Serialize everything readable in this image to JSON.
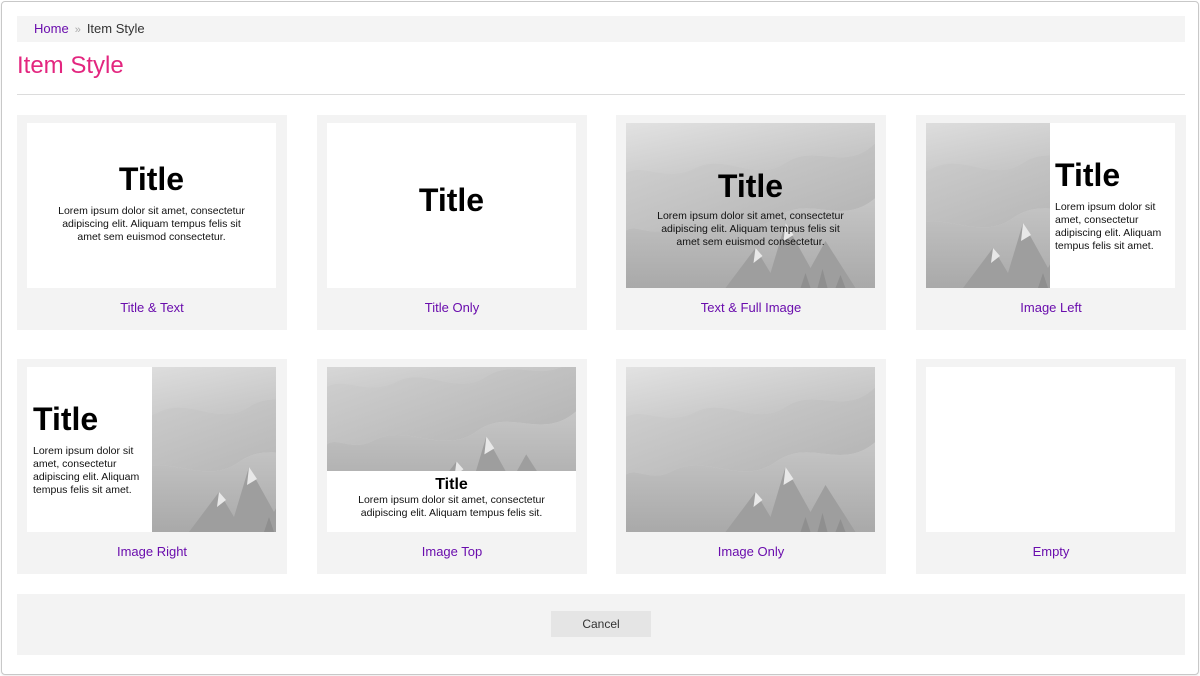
{
  "breadcrumb": {
    "home": "Home",
    "separator": "»",
    "current": "Item Style"
  },
  "page_title": "Item Style",
  "preview": {
    "title": "Title",
    "text_long": "Lorem ipsum dolor sit amet, consectetur adipiscing elit. Aliquam tempus felis sit amet sem euismod consectetur.",
    "text_side": "Lorem ipsum dolor sit amet, consectetur adipiscing elit. Aliquam tempus felis sit amet.",
    "text_short": "Lorem ipsum dolor sit amet, consectetur adipiscing elit. Aliquam tempus felis sit."
  },
  "styles": [
    {
      "label": "Title & Text"
    },
    {
      "label": "Title Only"
    },
    {
      "label": "Text & Full Image"
    },
    {
      "label": "Image Left"
    },
    {
      "label": "Image Right"
    },
    {
      "label": "Image Top"
    },
    {
      "label": "Image Only"
    },
    {
      "label": "Empty"
    }
  ],
  "footer": {
    "cancel_label": "Cancel"
  },
  "colors": {
    "accent": "#e3267f",
    "link": "#6a0dad",
    "panel": "#f3f3f3"
  }
}
